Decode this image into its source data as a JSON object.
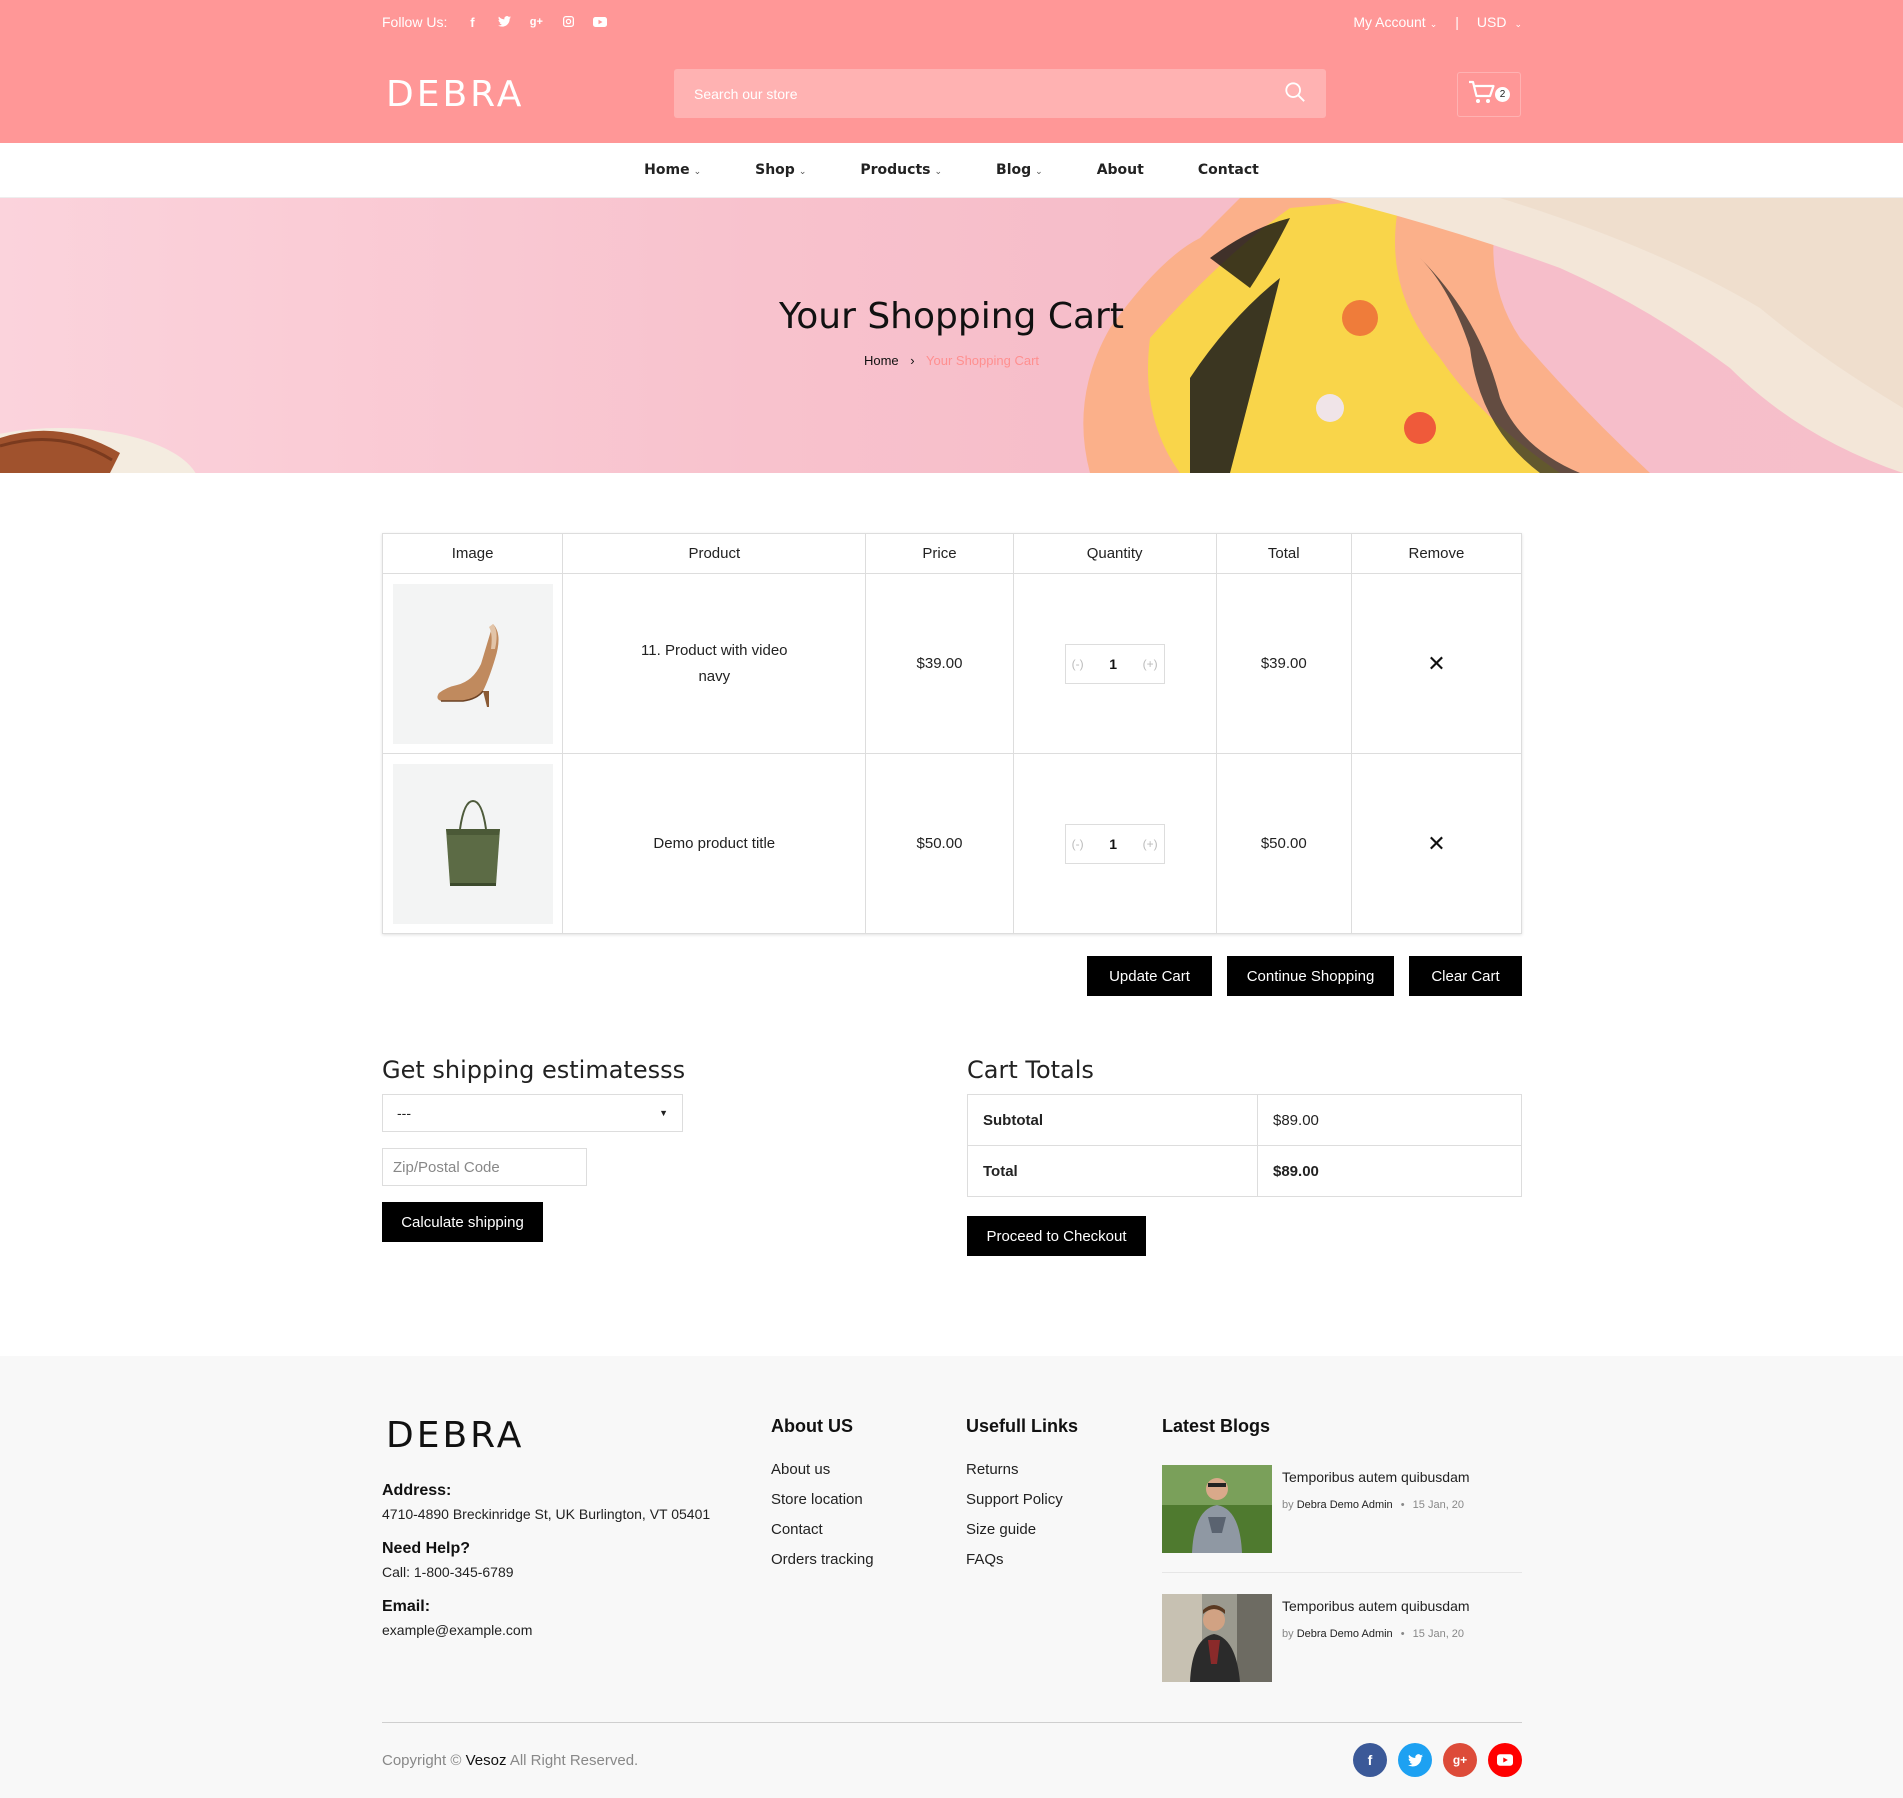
{
  "topbar": {
    "follow_label": "Follow Us:",
    "social": [
      "facebook-icon",
      "twitter-icon",
      "google-plus-icon",
      "instagram-icon",
      "youtube-icon"
    ],
    "my_account": "My Account",
    "separator": "|",
    "currency": "USD"
  },
  "brand": {
    "logo": "DEBRA"
  },
  "search": {
    "placeholder": "Search our store"
  },
  "cart": {
    "count": "2"
  },
  "nav": {
    "home": "Home",
    "shop": "Shop",
    "products": "Products",
    "blog": "Blog",
    "about": "About",
    "contact": "Contact"
  },
  "hero": {
    "title": "Your Shopping Cart",
    "breadcrumb_home": "Home",
    "breadcrumb_sep": "›",
    "breadcrumb_current": "Your Shopping Cart"
  },
  "cart_table": {
    "headers": [
      "Image",
      "Product",
      "Price",
      "Quantity",
      "Total",
      "Remove"
    ],
    "rows": [
      {
        "name": "11. Product with video",
        "variant": "navy",
        "price": "$39.00",
        "qty": "1",
        "total": "$39.00",
        "image": "heel-shoe-image"
      },
      {
        "name": "Demo product title",
        "variant": "",
        "price": "$50.00",
        "qty": "1",
        "total": "$50.00",
        "image": "tote-bag-image"
      }
    ],
    "qty_minus": "(-)",
    "qty_plus": "(+)",
    "remove": "✕"
  },
  "actions": {
    "update": "Update Cart",
    "continue": "Continue Shopping",
    "clear": "Clear Cart"
  },
  "shipping": {
    "title": "Get shipping estimatesss",
    "select_value": "---",
    "zip_placeholder": "Zip/Postal Code",
    "calc_button": "Calculate shipping"
  },
  "totals": {
    "title": "Cart Totals",
    "subtotal_label": "Subtotal",
    "subtotal_value": "$89.00",
    "total_label": "Total",
    "total_value": "$89.00",
    "checkout_button": "Proceed to Checkout"
  },
  "footer": {
    "address_label": "Address:",
    "address": "4710-4890 Breckinridge St, UK Burlington, VT 05401",
    "help_label": "Need Help?",
    "phone": "Call: 1-800-345-6789",
    "email_label": "Email:",
    "email": "example@example.com",
    "about_title": "About US",
    "about_links": [
      "About us",
      "Store location",
      "Contact",
      "Orders tracking"
    ],
    "useful_title": "Usefull Links",
    "useful_links": [
      "Returns",
      "Support Policy",
      "Size guide",
      "FAQs"
    ],
    "blogs_title": "Latest Blogs",
    "blogs": [
      {
        "title": "Temporibus autem quibusdam",
        "by": "by",
        "author": "Debra Demo Admin",
        "dot": "•",
        "date": "15 Jan, 20"
      },
      {
        "title": "Temporibus autem quibusdam",
        "by": "by",
        "author": "Debra Demo Admin",
        "dot": "•",
        "date": "15 Jan, 20"
      }
    ],
    "copyright_prefix": "Copyright ©",
    "copyright_brand": "Vesoz",
    "copyright_suffix": "All Right Reserved.",
    "social_colors": {
      "facebook": "#3b5998",
      "twitter": "#1da1f2",
      "google": "#dd4b39",
      "youtube": "#ff0000"
    }
  },
  "colors": {
    "header_pink": "#ff9797",
    "search_pink": "#ffb2b2",
    "breadcrumb_active": "#ff8f8f"
  }
}
